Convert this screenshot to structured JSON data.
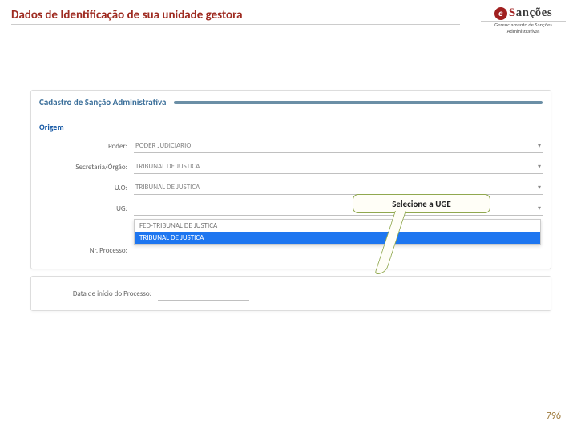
{
  "slide": {
    "title": "Dados de Identificação de sua unidade gestora",
    "page_number": "796"
  },
  "logo": {
    "badge_letter": "e",
    "word_prefix": "S",
    "word_rest": "anções",
    "subtitle": "Gerenciamento de Sanções Administrativas"
  },
  "form": {
    "panel_title": "Cadastro de Sanção Administrativa",
    "section_label": "Origem",
    "rows": {
      "poder": {
        "label": "Poder:",
        "value": "PODER JUDICIARIO"
      },
      "secretaria": {
        "label": "Secretaria/Órgão:",
        "value": "TRIBUNAL DE JUSTICA"
      },
      "uo": {
        "label": "U.O:",
        "value": "TRIBUNAL DE JUSTICA"
      },
      "ug": {
        "label": "UG:",
        "value": ""
      },
      "nr_processo": {
        "label": "Nr. Processo:",
        "value": ""
      },
      "data_inicio": {
        "label": "Data de início do Processo:",
        "value": ""
      }
    },
    "ug_dropdown": {
      "option1": "FED-TRIBUNAL DE JUSTICA",
      "option2": "TRIBUNAL DE JUSTICA"
    }
  },
  "callout": {
    "text": "Selecione a UGE"
  }
}
